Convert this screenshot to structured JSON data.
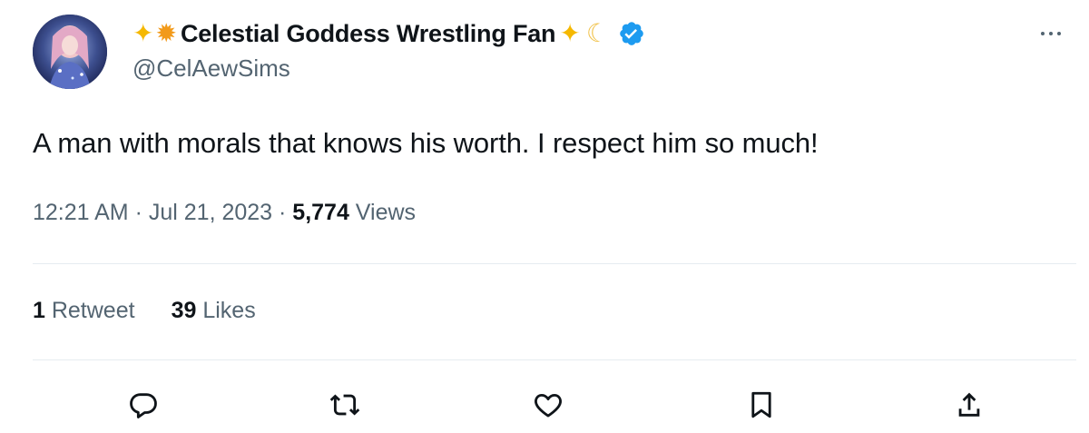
{
  "author": {
    "display_name": "Celestial Goddess Wrestling Fan",
    "handle": "@CelAewSims",
    "name_emoji_before": [
      "sparkles",
      "glowing-star"
    ],
    "name_emoji_after": [
      "sparkles",
      "crescent-moon"
    ],
    "verified_badge_color": "#1d9bf0"
  },
  "tweet": {
    "text": "A man with morals that knows his worth. I respect him so much!",
    "time": "12:21 AM",
    "sep1": " · ",
    "date": "Jul 21, 2023",
    "sep2": " · ",
    "views_count": "5,774",
    "views_label": " Views"
  },
  "stats": {
    "retweets_count": "1",
    "retweets_label": " Retweet",
    "likes_count": "39",
    "likes_label": " Likes"
  },
  "actions": [
    {
      "name": "reply-icon"
    },
    {
      "name": "retweet-icon"
    },
    {
      "name": "like-icon"
    },
    {
      "name": "bookmark-icon"
    },
    {
      "name": "share-icon"
    }
  ],
  "colors": {
    "text_primary": "#0f1419",
    "text_secondary": "#536471",
    "divider": "#e6ecf0"
  }
}
